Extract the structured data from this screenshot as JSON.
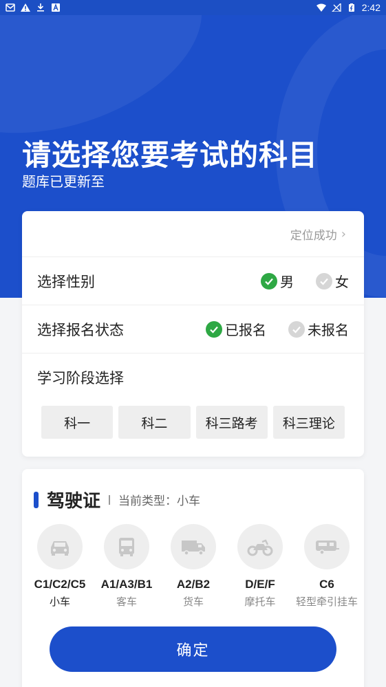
{
  "status_bar": {
    "time": "2:42",
    "left_icons": [
      "mail-icon",
      "warning-icon",
      "download-icon",
      "app-a-icon"
    ],
    "right_icons": [
      "wifi-icon",
      "no-signal-icon",
      "battery-icon"
    ]
  },
  "hero": {
    "title": "请选择您要考试的科目",
    "subtitle": "题库已更新至"
  },
  "location": {
    "status": "定位成功",
    "chevron": "›"
  },
  "gender": {
    "label": "选择性别",
    "options": [
      {
        "label": "男",
        "selected": true
      },
      {
        "label": "女",
        "selected": false
      }
    ]
  },
  "registration": {
    "label": "选择报名状态",
    "options": [
      {
        "label": "已报名",
        "selected": true
      },
      {
        "label": "未报名",
        "selected": false
      }
    ]
  },
  "stage": {
    "label": "学习阶段选择",
    "options": [
      "科一",
      "科二",
      "科三路考",
      "科三理论"
    ]
  },
  "license": {
    "title": "驾驶证",
    "current_type": "当前类型：小车",
    "vehicles": [
      {
        "code": "C1/C2/C5",
        "name": "小车",
        "icon": "car-icon"
      },
      {
        "code": "A1/A3/B1",
        "name": "客车",
        "icon": "bus-icon"
      },
      {
        "code": "A2/B2",
        "name": "货车",
        "icon": "truck-icon"
      },
      {
        "code": "D/E/F",
        "name": "摩托车",
        "icon": "motorcycle-icon"
      },
      {
        "code": "C6",
        "name": "轻型牵引挂车",
        "icon": "trailer-icon"
      }
    ]
  },
  "confirm_label": "确定",
  "colors": {
    "primary": "#1c4fcb",
    "check_on": "#2ea844",
    "check_off": "#d6d6d6",
    "icon_gray": "#c7c7c7"
  }
}
